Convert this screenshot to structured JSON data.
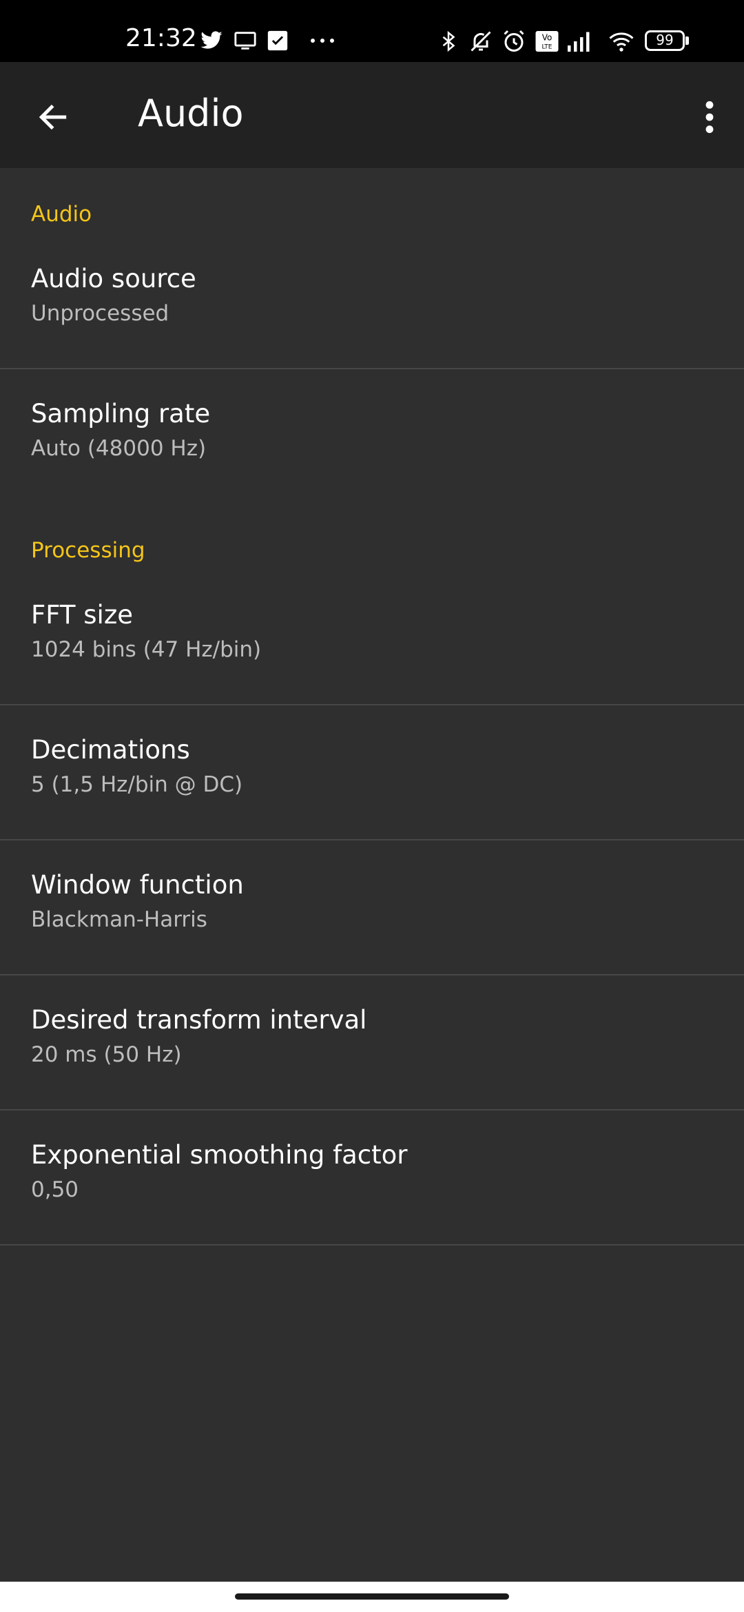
{
  "status_bar": {
    "time": "21:32",
    "left_icons": [
      "twitter-icon",
      "cast-icon",
      "task-check-icon",
      "more-notifications-icon"
    ],
    "right_icons": [
      "bluetooth-icon",
      "muted-bell-icon",
      "alarm-icon",
      "volte-icon",
      "cell-signal-icon",
      "wifi-icon",
      "battery-icon"
    ],
    "battery": "99"
  },
  "app_bar": {
    "title": "Audio",
    "back_icon": "back-arrow-icon",
    "menu_icon": "more-vert-icon"
  },
  "sections": [
    {
      "header": "Audio",
      "items": [
        {
          "title": "Audio source",
          "summary": "Unprocessed"
        },
        {
          "title": "Sampling rate",
          "summary": "Auto (48000 Hz)"
        }
      ]
    },
    {
      "header": "Processing",
      "items": [
        {
          "title": "FFT size",
          "summary": "1024 bins (47 Hz/bin)"
        },
        {
          "title": "Decimations",
          "summary": "5 (1,5 Hz/bin @ DC)"
        },
        {
          "title": "Window function",
          "summary": "Blackman-Harris"
        },
        {
          "title": "Desired transform interval",
          "summary": "20 ms (50 Hz)"
        },
        {
          "title": "Exponential smoothing factor",
          "summary": "0,50"
        }
      ]
    }
  ],
  "colors": {
    "accent": "#f5c518",
    "background": "#2f2f2f",
    "app_bar": "#222222",
    "divider": "#474747"
  }
}
